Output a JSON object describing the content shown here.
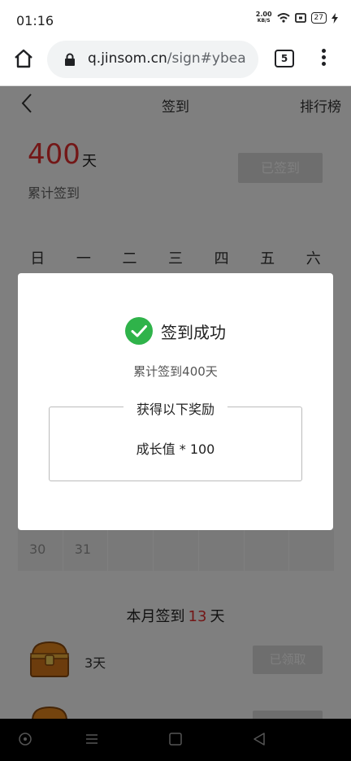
{
  "status_bar": {
    "time": "01:16",
    "net_speed": "2.00",
    "net_unit": "KB/S",
    "battery": "27"
  },
  "browser": {
    "url_domain": "q.jinsom.cn",
    "url_path": "/sign#ybea",
    "tab_count": "5"
  },
  "page": {
    "title": "签到",
    "rank_link": "排行榜",
    "total_count": "400",
    "total_unit": "天",
    "total_label": "累计签到",
    "signed_button": "已签到",
    "weekdays": [
      "日",
      "一",
      "二",
      "三",
      "四",
      "五",
      "六"
    ],
    "last_row_days": [
      "30",
      "31",
      "",
      "",
      "",
      "",
      ""
    ],
    "month_prefix": "本月签到",
    "month_count": "13",
    "month_suffix": "天",
    "rewards": [
      {
        "day": "3天",
        "button": "已领取"
      },
      {
        "day": "",
        "button": ""
      }
    ]
  },
  "dialog": {
    "success_text": "签到成功",
    "total_text": "累计签到400天",
    "reward_title": "获得以下奖励",
    "reward_item": "成长值 * 100"
  },
  "colors": {
    "accent_red": "#e62e2e",
    "success_green": "#2fb34a",
    "chest_orange": "#e8891d"
  }
}
